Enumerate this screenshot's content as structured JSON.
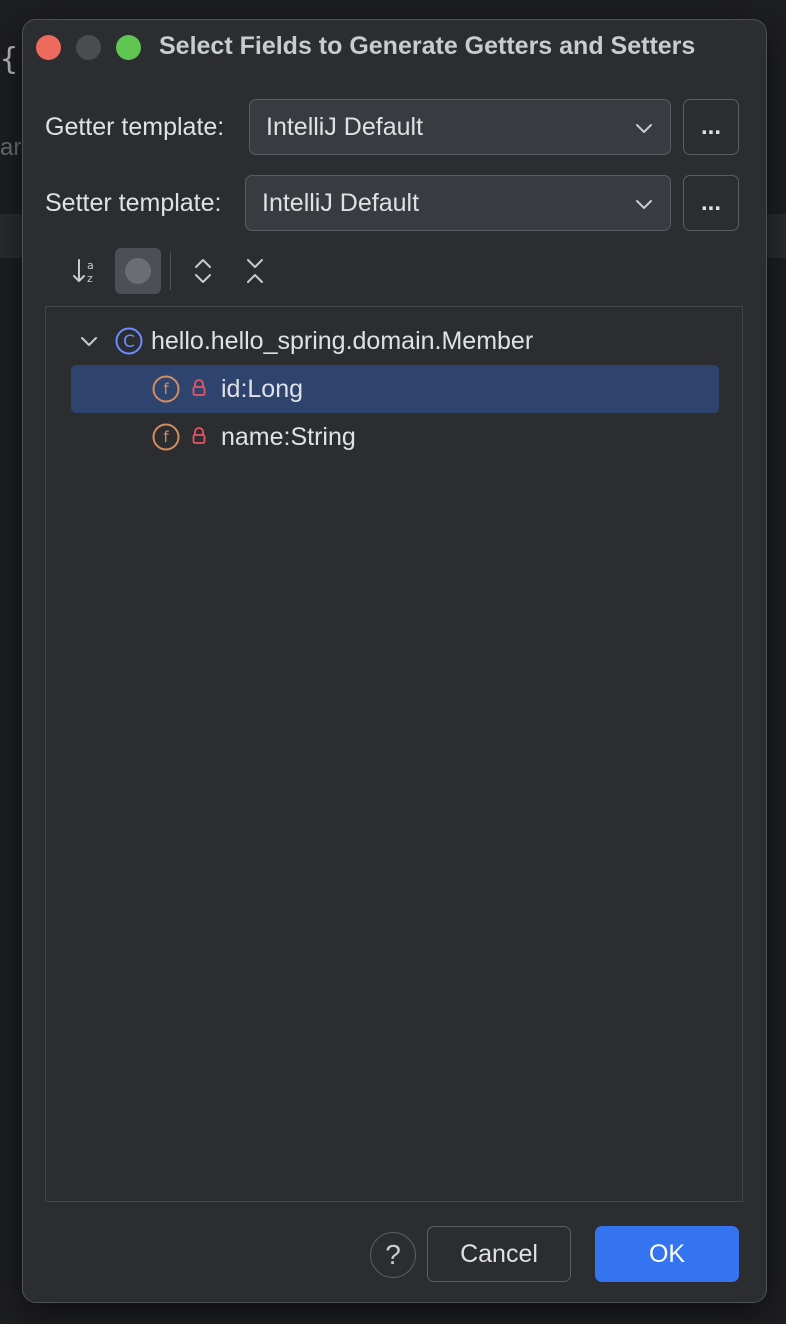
{
  "background": {
    "brace": "{",
    "fragment": "ar"
  },
  "dialog": {
    "title": "Select Fields to Generate Getters and Setters",
    "getter": {
      "label": "Getter template:",
      "value": "IntelliJ Default",
      "more_label": "..."
    },
    "setter": {
      "label": "Setter template:",
      "value": "IntelliJ Default",
      "more_label": "..."
    },
    "toolbar": {
      "icons": [
        "sort-alphabetically-icon",
        "show-inherited-icon",
        "expand-all-icon",
        "collapse-all-icon"
      ]
    },
    "tree": {
      "root": {
        "label": "hello.hello_spring.domain.Member",
        "icon": "class-icon",
        "expanded": true
      },
      "fields": [
        {
          "label": "id:Long",
          "icon": "field-icon",
          "visibility": "private-lock-icon",
          "selected": true
        },
        {
          "label": "name:String",
          "icon": "field-icon",
          "visibility": "private-lock-icon",
          "selected": false
        }
      ]
    },
    "footer": {
      "help_label": "?",
      "cancel_label": "Cancel",
      "ok_label": "OK"
    }
  },
  "colors": {
    "dialog_bg": "#2b2d30",
    "selection": "#2e436e",
    "primary_button": "#3574f0",
    "class_icon": "#6c8cff",
    "field_icon": "#d38d5f",
    "lock_icon": "#e55765",
    "close": "#ec6a5e",
    "maximize": "#61c554"
  }
}
